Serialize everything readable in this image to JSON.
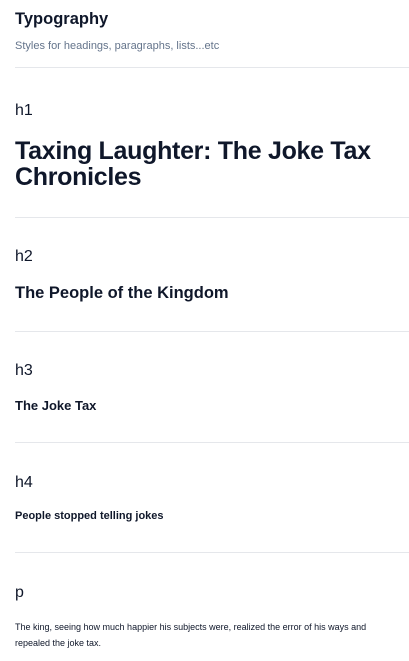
{
  "header": {
    "title": "Typography",
    "subtitle": "Styles for headings, paragraphs, lists...etc"
  },
  "sections": [
    {
      "label": "h1",
      "sample": "Taxing Laughter: The Joke Tax Chronicles"
    },
    {
      "label": "h2",
      "sample": "The People of the Kingdom"
    },
    {
      "label": "h3",
      "sample": "The Joke Tax"
    },
    {
      "label": "h4",
      "sample": "People stopped telling jokes"
    },
    {
      "label": "p",
      "sample": "The king, seeing how much happier his subjects were, realized the error of his ways and repealed the joke tax."
    }
  ]
}
